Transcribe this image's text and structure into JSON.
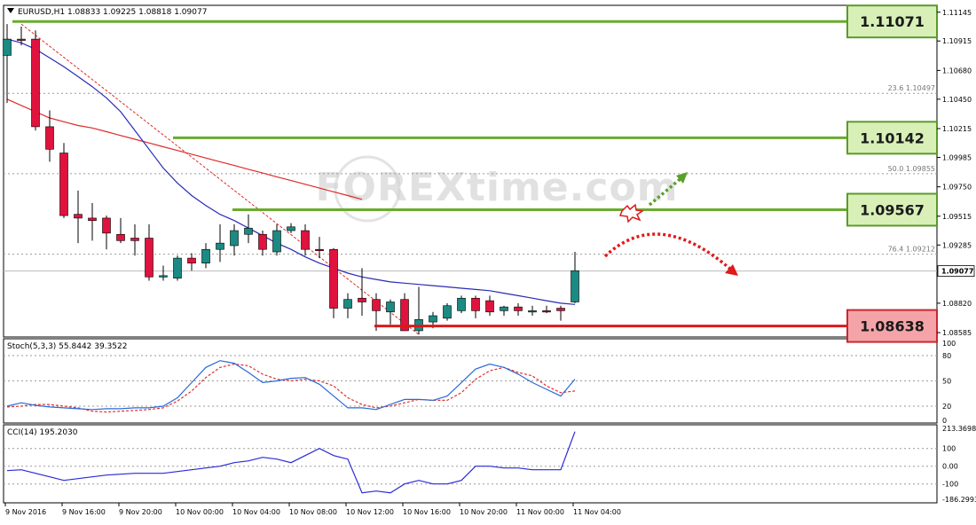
{
  "header": {
    "symbol_info": "EURUSD,H1  1.08833 1.09225 1.08818 1.09077"
  },
  "watermark": {
    "text": "FOREXtime.com"
  },
  "colors": {
    "bull": "#1a8a82",
    "bear": "#e0123e",
    "ma_fast": "#2a2ab8",
    "ma_slow": "#e02a2a",
    "level_line": "#6aab2e",
    "support_line": "#d81a1a",
    "grid": "#9a9a9a",
    "stoch_main": "#2a6ad8",
    "stoch_signal": "#e03030",
    "cci": "#2a2ad8",
    "label_green_fill": "#d8f0b8",
    "label_green_border": "#5a9a2a",
    "label_red_fill": "#f4a4a8",
    "label_red_border": "#c8282e",
    "arrow_green": "#5aa02a",
    "arrow_red": "#e01a1a"
  },
  "chart_data": [
    {
      "type": "candlestick",
      "name": "main",
      "symbol": "EURUSD",
      "timeframe": "H1",
      "ylim": [
        1.0855,
        1.112
      ],
      "y_ticks": [
        "1.11145",
        "1.10915",
        "1.10680",
        "1.10450",
        "1.10215",
        "1.09985",
        "1.09750",
        "1.09515",
        "1.09285",
        "1.09077",
        "1.08820",
        "1.08585"
      ],
      "x_ticks": [
        "9 Nov 2016",
        "9 Nov 16:00",
        "9 Nov 20:00",
        "10 Nov 00:00",
        "10 Nov 04:00",
        "10 Nov 08:00",
        "10 Nov 12:00",
        "10 Nov 16:00",
        "10 Nov 20:00",
        "11 Nov 00:00",
        "11 Nov 04:00"
      ],
      "candles": [
        {
          "o": 1.108,
          "h": 1.1105,
          "l": 1.1042,
          "c": 1.1093
        },
        {
          "o": 1.1093,
          "h": 1.1103,
          "l": 1.1088,
          "c": 1.1092
        },
        {
          "o": 1.1093,
          "h": 1.11,
          "l": 1.102,
          "c": 1.1023
        },
        {
          "o": 1.1023,
          "h": 1.1036,
          "l": 1.0995,
          "c": 1.1005
        },
        {
          "o": 1.1002,
          "h": 1.101,
          "l": 1.095,
          "c": 1.0952
        },
        {
          "o": 1.0953,
          "h": 1.0972,
          "l": 1.093,
          "c": 1.095
        },
        {
          "o": 1.095,
          "h": 1.0962,
          "l": 1.0932,
          "c": 1.0948
        },
        {
          "o": 1.095,
          "h": 1.0952,
          "l": 1.0925,
          "c": 1.0938
        },
        {
          "o": 1.0937,
          "h": 1.095,
          "l": 1.093,
          "c": 1.0932
        },
        {
          "o": 1.0934,
          "h": 1.0945,
          "l": 1.092,
          "c": 1.0932
        },
        {
          "o": 1.0934,
          "h": 1.0945,
          "l": 1.09,
          "c": 1.0903
        },
        {
          "o": 1.0903,
          "h": 1.0912,
          "l": 1.09,
          "c": 1.0904
        },
        {
          "o": 1.0902,
          "h": 1.092,
          "l": 1.09,
          "c": 1.0918
        },
        {
          "o": 1.0918,
          "h": 1.0922,
          "l": 1.0908,
          "c": 1.0914
        },
        {
          "o": 1.0914,
          "h": 1.093,
          "l": 1.091,
          "c": 1.0925
        },
        {
          "o": 1.0925,
          "h": 1.0945,
          "l": 1.0915,
          "c": 1.093
        },
        {
          "o": 1.0928,
          "h": 1.0945,
          "l": 1.092,
          "c": 1.094
        },
        {
          "o": 1.0937,
          "h": 1.0953,
          "l": 1.093,
          "c": 1.0942
        },
        {
          "o": 1.0937,
          "h": 1.094,
          "l": 1.092,
          "c": 1.0925
        },
        {
          "o": 1.0923,
          "h": 1.0945,
          "l": 1.092,
          "c": 1.094
        },
        {
          "o": 1.094,
          "h": 1.0946,
          "l": 1.0938,
          "c": 1.0943
        },
        {
          "o": 1.094,
          "h": 1.0945,
          "l": 1.092,
          "c": 1.0925
        },
        {
          "o": 1.0925,
          "h": 1.0935,
          "l": 1.0918,
          "c": 1.0924
        },
        {
          "o": 1.0925,
          "h": 1.0926,
          "l": 1.087,
          "c": 1.0878
        },
        {
          "o": 1.0878,
          "h": 1.089,
          "l": 1.087,
          "c": 1.0885
        },
        {
          "o": 1.0886,
          "h": 1.091,
          "l": 1.0872,
          "c": 1.0883
        },
        {
          "o": 1.0885,
          "h": 1.089,
          "l": 1.086,
          "c": 1.0876
        },
        {
          "o": 1.0875,
          "h": 1.0885,
          "l": 1.0865,
          "c": 1.0883
        },
        {
          "o": 1.0885,
          "h": 1.089,
          "l": 1.086,
          "c": 1.086
        },
        {
          "o": 1.086,
          "h": 1.0895,
          "l": 1.0857,
          "c": 1.0869
        },
        {
          "o": 1.0867,
          "h": 1.0875,
          "l": 1.0862,
          "c": 1.0872
        },
        {
          "o": 1.087,
          "h": 1.0882,
          "l": 1.0868,
          "c": 1.088
        },
        {
          "o": 1.0876,
          "h": 1.0888,
          "l": 1.0874,
          "c": 1.0886
        },
        {
          "o": 1.0886,
          "h": 1.0888,
          "l": 1.087,
          "c": 1.0876
        },
        {
          "o": 1.0884,
          "h": 1.0888,
          "l": 1.0872,
          "c": 1.0875
        },
        {
          "o": 1.0876,
          "h": 1.088,
          "l": 1.0872,
          "c": 1.0879
        },
        {
          "o": 1.0879,
          "h": 1.0882,
          "l": 1.0872,
          "c": 1.0876
        },
        {
          "o": 1.0875,
          "h": 1.088,
          "l": 1.0872,
          "c": 1.0876
        },
        {
          "o": 1.0876,
          "h": 1.088,
          "l": 1.0874,
          "c": 1.0875
        },
        {
          "o": 1.0878,
          "h": 1.088,
          "l": 1.0868,
          "c": 1.0876
        },
        {
          "o": 1.0883,
          "h": 1.0923,
          "l": 1.0882,
          "c": 1.0908
        }
      ],
      "ma_fast": [
        1.1093,
        1.109,
        1.1085,
        1.1078,
        1.1071,
        1.1063,
        1.1055,
        1.1046,
        1.1035,
        1.102,
        1.1005,
        1.099,
        1.0978,
        1.0968,
        1.096,
        1.0953,
        1.0948,
        1.0942,
        1.0936,
        1.093,
        1.0925,
        1.0919,
        1.0914,
        1.091,
        1.0906,
        1.0903,
        1.0901,
        1.0899,
        1.0898,
        1.0897,
        1.0896,
        1.0895,
        1.0894,
        1.0893,
        1.0892,
        1.089,
        1.0888,
        1.0886,
        1.0884,
        1.0882,
        1.0881
      ],
      "ma_slow": [
        1.1045,
        1.104,
        1.1035,
        1.103,
        1.1027,
        1.1024,
        1.1022,
        1.1019,
        1.1016,
        1.1013,
        1.101,
        1.1007,
        1.1004,
        1.1001,
        1.0998,
        1.0995,
        1.0992,
        1.0989,
        1.0986,
        1.0983,
        1.098,
        1.0977,
        1.0974,
        1.0971,
        1.0968,
        1.0965
      ],
      "fib_levels": [
        {
          "label": "23.6  1.10497",
          "value": 1.10497
        },
        {
          "label": "50.0  1.09855",
          "value": 1.09855
        },
        {
          "label": "76.4  1.09212",
          "value": 1.09212
        }
      ],
      "levels": [
        {
          "label": "1.11071",
          "value": 1.11071,
          "kind": "resistance"
        },
        {
          "label": "1.10142",
          "value": 1.10142,
          "kind": "resistance"
        },
        {
          "label": "1.09567",
          "value": 1.09567,
          "kind": "resistance"
        },
        {
          "label": "1.08638",
          "value": 1.08638,
          "kind": "support"
        }
      ],
      "last_price_label": "1.09077",
      "last_price": 1.09077
    },
    {
      "type": "line",
      "name": "stochastic",
      "title": "Stoch(5,3,3) 55.8442 39.3522",
      "ylim": [
        0,
        100
      ],
      "y_ticks": [
        "100",
        "80",
        "50",
        "20",
        "0"
      ],
      "series": [
        {
          "values": [
            20,
            24,
            21,
            19,
            18,
            17,
            16,
            17,
            17,
            18,
            18,
            20,
            30,
            48,
            66,
            74,
            71,
            60,
            48,
            50,
            53,
            54,
            46,
            32,
            18,
            18,
            16,
            22,
            28,
            28,
            27,
            32,
            48,
            64,
            70,
            66,
            58,
            48,
            40,
            32,
            52
          ]
        },
        {
          "values": [
            19,
            20,
            22,
            22,
            20,
            18,
            14,
            13,
            14,
            15,
            16,
            18,
            26,
            38,
            54,
            66,
            70,
            68,
            58,
            52,
            50,
            52,
            50,
            44,
            30,
            22,
            18,
            20,
            24,
            28,
            27,
            27,
            36,
            52,
            62,
            66,
            60,
            56,
            44,
            36,
            38
          ]
        }
      ]
    },
    {
      "type": "line",
      "name": "cci",
      "title": "CCI(14) 195.2030",
      "ylim": [
        -186.2993,
        213.3698
      ],
      "y_ticks": [
        "213.3698",
        "100",
        "0.00",
        "-100",
        "-186.2993"
      ],
      "series": [
        {
          "values": [
            -25,
            -20,
            -40,
            -60,
            -80,
            -70,
            -60,
            -50,
            -45,
            -40,
            -40,
            -40,
            -30,
            -20,
            -10,
            0,
            20,
            30,
            50,
            40,
            20,
            60,
            100,
            60,
            40,
            -150,
            -140,
            -150,
            -100,
            -80,
            -100,
            -100,
            -80,
            0,
            0,
            -10,
            -10,
            -20,
            -20,
            -20,
            195
          ]
        }
      ]
    }
  ]
}
